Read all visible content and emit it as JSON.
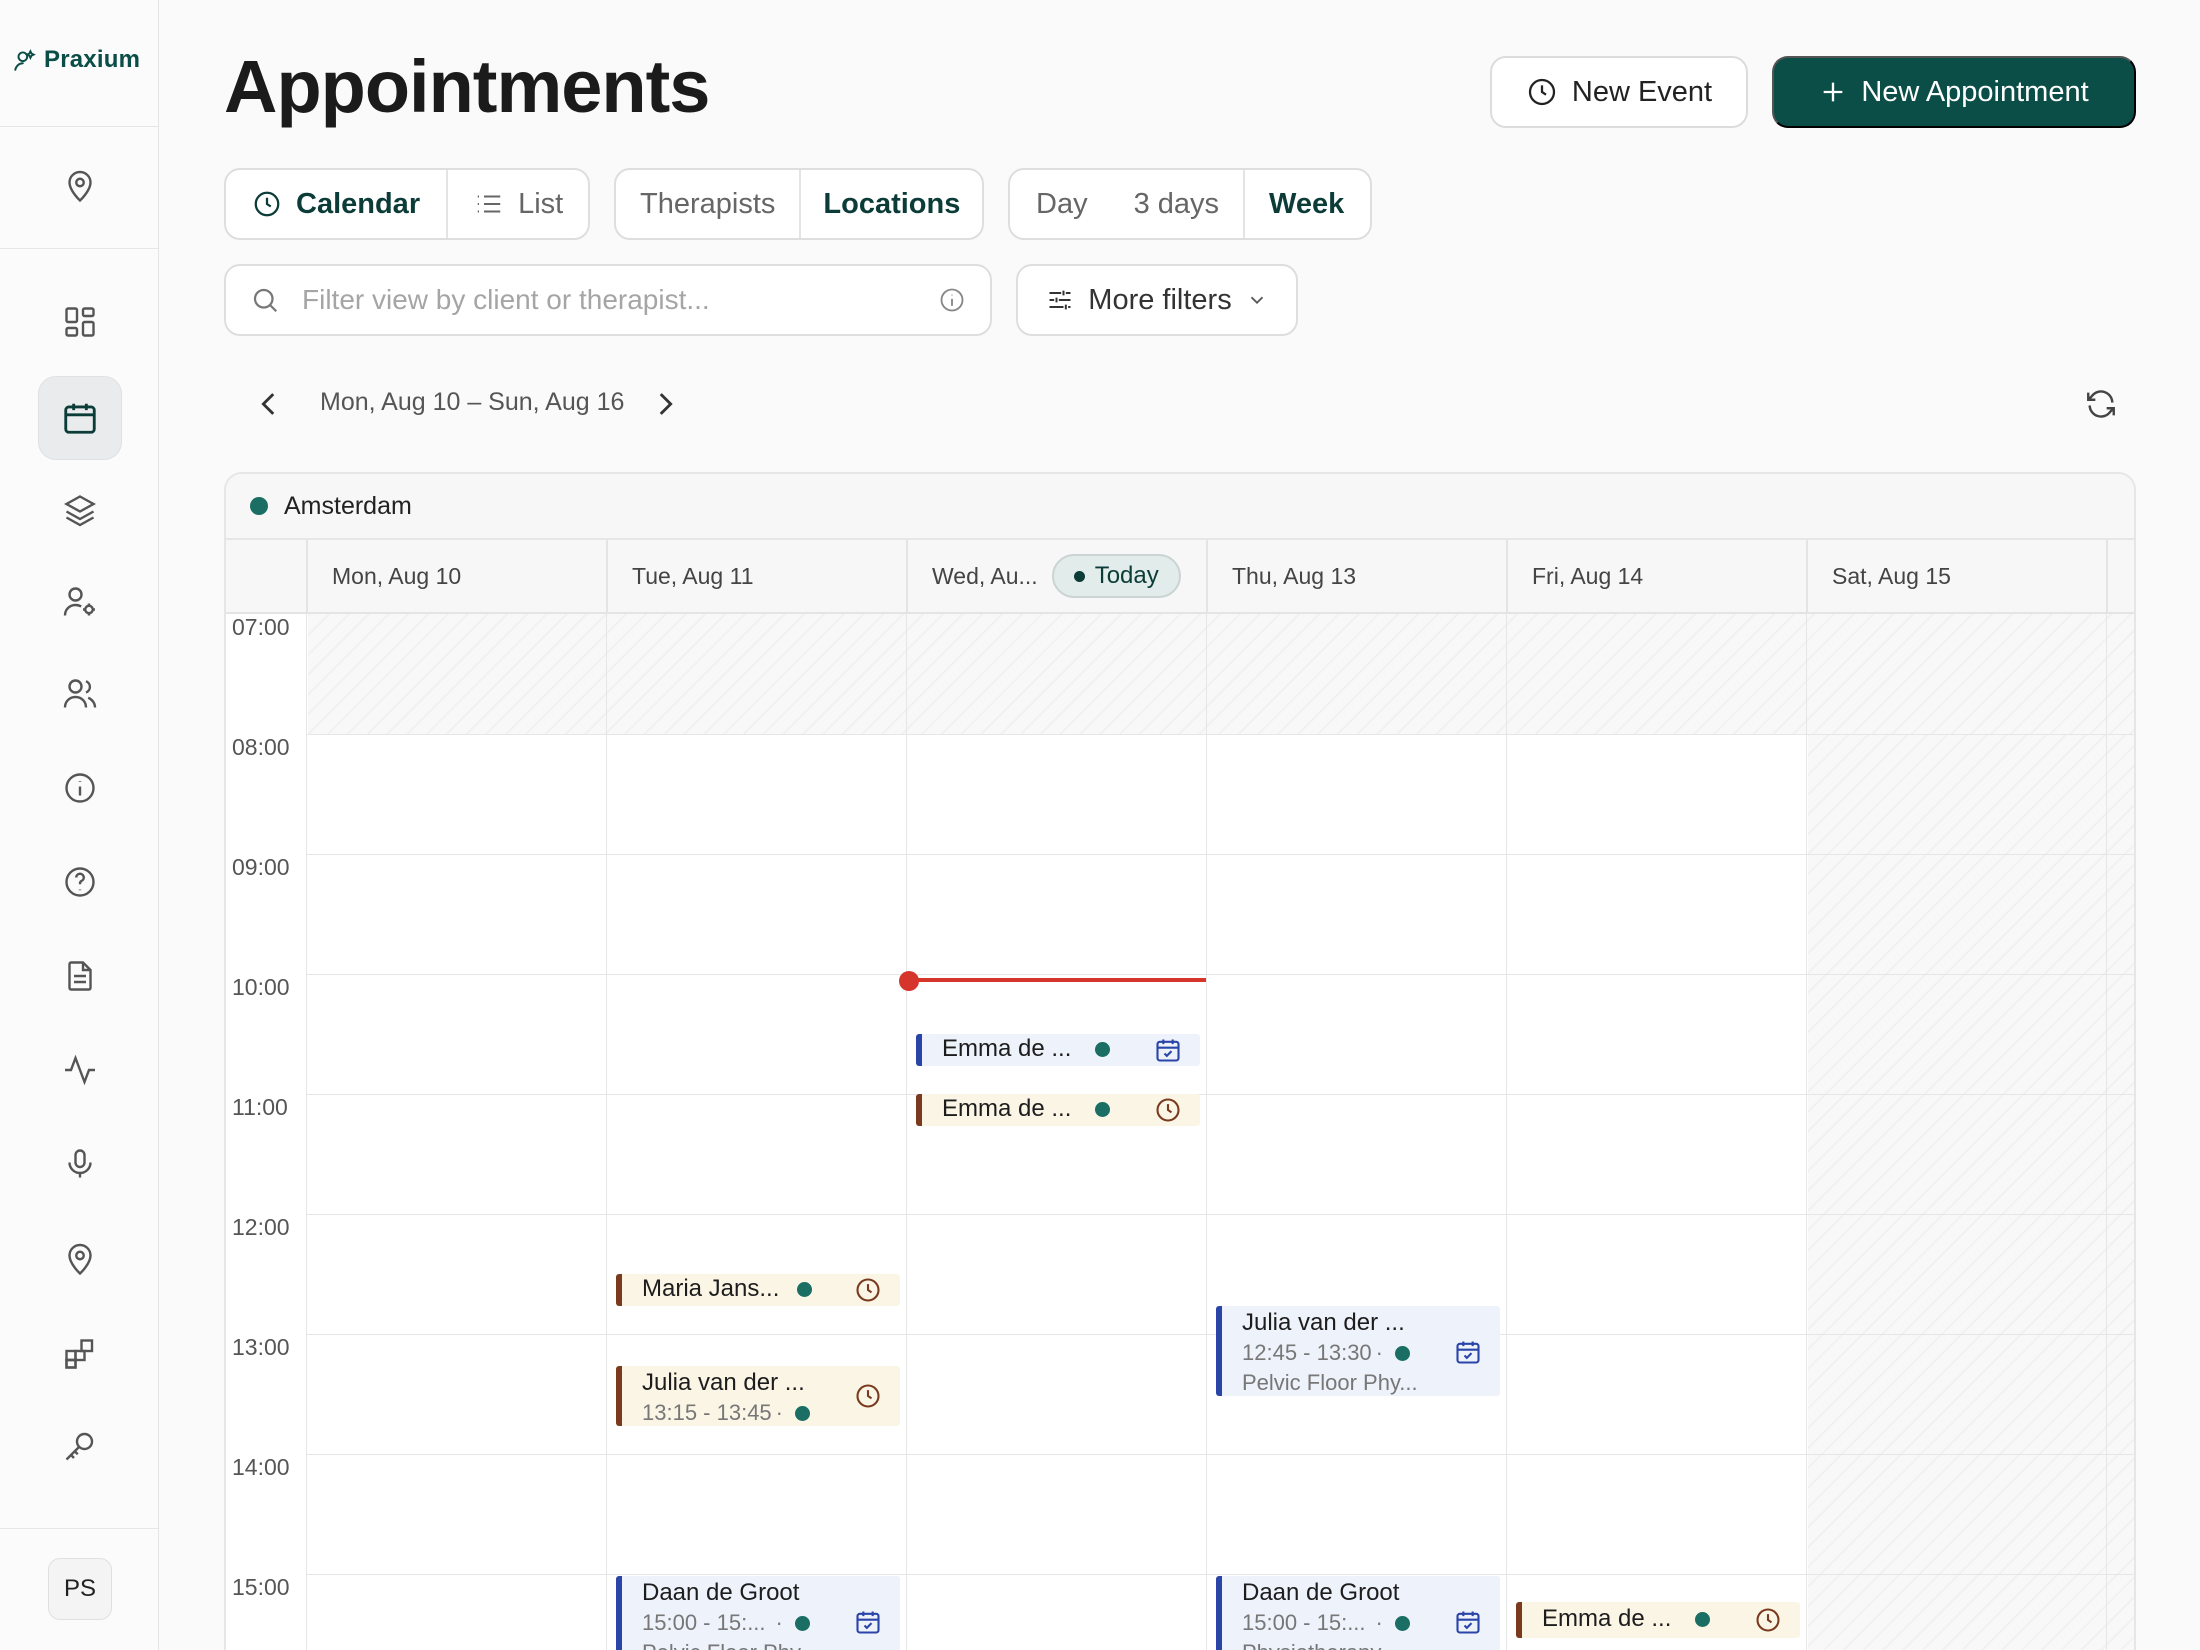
{
  "brand": {
    "name": "Praxium",
    "accent": "#0b4d47"
  },
  "user": {
    "initials": "PS"
  },
  "sidebar": {
    "items": [
      {
        "icon": "map-pin-icon"
      },
      {
        "icon": "dashboard-grid-icon"
      },
      {
        "icon": "calendar-icon",
        "active": true
      },
      {
        "icon": "layers-icon"
      },
      {
        "icon": "user-settings-icon"
      },
      {
        "icon": "users-icon"
      },
      {
        "icon": "info-icon"
      },
      {
        "icon": "help-icon"
      },
      {
        "icon": "document-icon"
      },
      {
        "icon": "activity-icon"
      },
      {
        "icon": "microphone-icon"
      },
      {
        "icon": "location-icon"
      },
      {
        "icon": "widgets-icon"
      },
      {
        "icon": "key-icon"
      }
    ]
  },
  "header": {
    "title": "Appointments",
    "new_event_label": "New Event",
    "new_appointment_label": "New Appointment"
  },
  "view_mode": {
    "calendar": "Calendar",
    "list": "List",
    "selected": "Calendar"
  },
  "group_by": {
    "therapists": "Therapists",
    "locations": "Locations",
    "selected": "Locations"
  },
  "range": {
    "day": "Day",
    "three_days": "3 days",
    "week": "Week",
    "selected": "Week"
  },
  "search": {
    "placeholder": "Filter view by client or therapist...",
    "value": ""
  },
  "filters": {
    "label": "More filters"
  },
  "navigation": {
    "date_range": "Mon, Aug 10 – Sun, Aug 16"
  },
  "calendar": {
    "location": "Amsterdam",
    "today_label": "Today",
    "days": [
      "Mon, Aug 10",
      "Tue, Aug 11",
      "Wed, Au...",
      "Thu, Aug 13",
      "Fri, Aug 14",
      "Sat, Aug 15"
    ],
    "times": [
      "07:00",
      "08:00",
      "09:00",
      "10:00",
      "11:00",
      "12:00",
      "13:00",
      "14:00",
      "15:00"
    ],
    "events": [
      {
        "day": 2,
        "name": "Emma de ...",
        "kind": "appointment",
        "color": "blue"
      },
      {
        "day": 2,
        "name": "Emma de ...",
        "kind": "event",
        "color": "brown"
      },
      {
        "day": 1,
        "name": "Maria Jans...",
        "kind": "event",
        "color": "brown"
      },
      {
        "day": 3,
        "name": "Julia van der ...",
        "time": "12:45 - 13:30",
        "detail": "Pelvic Floor Phy...",
        "kind": "appointment",
        "color": "blue"
      },
      {
        "day": 1,
        "name": "Julia van der ...",
        "time": "13:15 - 13:45",
        "kind": "event",
        "color": "brown"
      },
      {
        "day": 1,
        "name": "Daan de Groot",
        "time": "15:00 - 15:...",
        "detail": "Pelvic Floor Phy...",
        "kind": "appointment",
        "color": "blue"
      },
      {
        "day": 3,
        "name": "Daan de Groot",
        "time": "15:00 - 15:...",
        "detail": "Physiotherapy",
        "kind": "appointment",
        "color": "blue"
      },
      {
        "day": 4,
        "name": "Emma de ...",
        "kind": "event",
        "color": "brown"
      }
    ]
  },
  "colors": {
    "appointment": "#2a44a8",
    "event": "#7a3a1e",
    "now_indicator": "#d6352c",
    "location_dot": "#1a6e63"
  }
}
